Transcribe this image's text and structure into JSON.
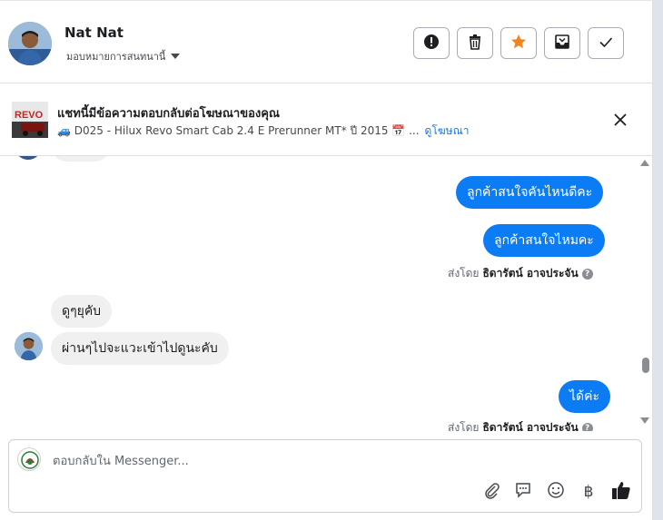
{
  "header": {
    "name": "Nat Nat",
    "assign_label": "มอบหมายการสนทนานี้",
    "buttons": {
      "report": "report-icon",
      "delete": "trash-icon",
      "star": "star-icon",
      "archive": "archive-icon",
      "done": "check-icon"
    }
  },
  "ad": {
    "title": "แชทนี้มีข้อความตอบกลับต่อโฆษณาของคุณ",
    "thumb_text": "REVO",
    "description": "🚙 D025 - Hilux Revo Smart Cab 2.4 E Prerunner MT* ปี 2015 📅 ...",
    "link": "ดูโฆษณา"
  },
  "messages": {
    "out_1": "ลูกค้าสนใจคันไหนดีคะ",
    "out_2": "ลูกค้าสนใจไหมคะ",
    "sent_by_label": "ส่งโดย",
    "sent_by_name": "ธิดารัตน์ อาจประจัน",
    "in_1": "ดูๆยุคับ",
    "in_2": "ผ่านๆไปจะแวะเข้าไปดูนะคับ",
    "out_3": "ได้ค่ะ",
    "help_glyph": "?"
  },
  "composer": {
    "placeholder": "ตอบกลับใน Messenger...",
    "tools": [
      "paperclip-icon",
      "chat-icon",
      "emoji-icon",
      "baht-icon",
      "thumbs-up-icon"
    ],
    "baht_glyph": "฿"
  },
  "colors": {
    "accent": "#0b7cf4",
    "link": "#1876f2",
    "star": "#f5821f"
  }
}
